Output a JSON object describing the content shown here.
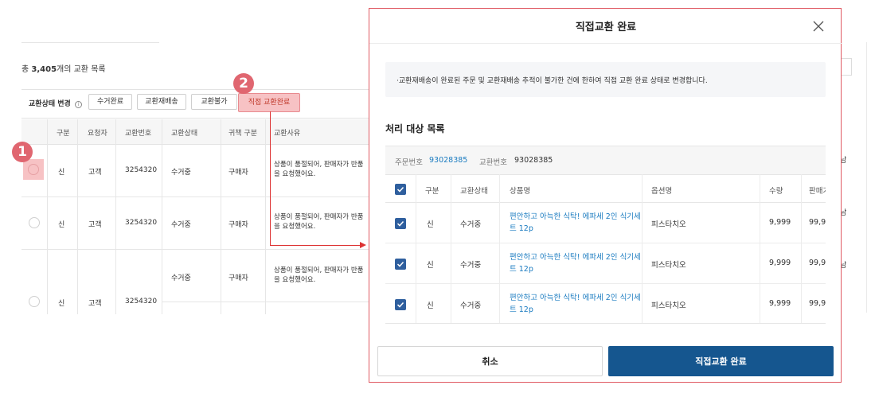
{
  "background": {
    "count_prefix": "총",
    "count_value": "3,405",
    "count_suffix": "개의 교환 목록",
    "status_label": "교환상태 변경",
    "info_icon": "ⓘ",
    "chips": [
      "수거완료",
      "교환재배송",
      "교환불가",
      "직접 교환완료"
    ],
    "columns": [
      "구분",
      "요청자",
      "교환번호",
      "교환상태",
      "귀책 구분",
      "교환사유"
    ],
    "rows": [
      {
        "type": "신",
        "requester": "고객",
        "number": "3254320",
        "status": "수거중",
        "fault": "구매자",
        "reason": "상품이 품절되어, 판매자가 반품을 요청했어요."
      },
      {
        "type": "신",
        "requester": "고객",
        "number": "3254320",
        "status": "수거중",
        "fault": "구매자",
        "reason": "상품이 품절되어, 판매자가 반품을 요청했어요."
      },
      {
        "type": "신",
        "requester": "고객",
        "number": "3254320",
        "status": "수거중",
        "fault": "구매자",
        "reason": "상품이 품절되어, 판매자가 반품을 요청했어요."
      }
    ],
    "side_text": [
      "남",
      "남",
      "남"
    ],
    "step_badges": [
      "1",
      "2"
    ]
  },
  "modal": {
    "title": "직접교환 완료",
    "notice": "·교환재배송이 완료된 주문 및 교환재배송 추적이 불가한 건에 한하여 직접 교환 완료 상태로 변경합니다.",
    "section_title": "처리 대상 목록",
    "order_label": "주문번호",
    "order_number": "93028385",
    "exchange_label": "교환번호",
    "exchange_number": "93028385",
    "columns": [
      "구분",
      "교환상태",
      "상품명",
      "옵션명",
      "수량",
      "판매가"
    ],
    "rows": [
      {
        "type": "신",
        "status": "수거중",
        "product": "편안하고 아늑한 식탁! 에파세 2인 식기세트 12p",
        "option": "피스타치오",
        "qty": "9,999",
        "price": "99,9"
      },
      {
        "type": "신",
        "status": "수거중",
        "product": "편안하고 아늑한 식탁! 에파세 2인 식기세트 12p",
        "option": "피스타치오",
        "qty": "9,999",
        "price": "99,9"
      },
      {
        "type": "신",
        "status": "수거중",
        "product": "편안하고 아늑한 식탁! 에파세 2인 식기세트 12p",
        "option": "피스타치오",
        "qty": "9,999",
        "price": "99,9"
      }
    ],
    "cancel_label": "취소",
    "confirm_label": "직접교환 완료"
  },
  "colors": {
    "primary": "#15568f",
    "link": "#1a7bc0",
    "highlight": "#f7c2c4",
    "badge": "#e06670",
    "annotation_line": "#dd3333"
  }
}
